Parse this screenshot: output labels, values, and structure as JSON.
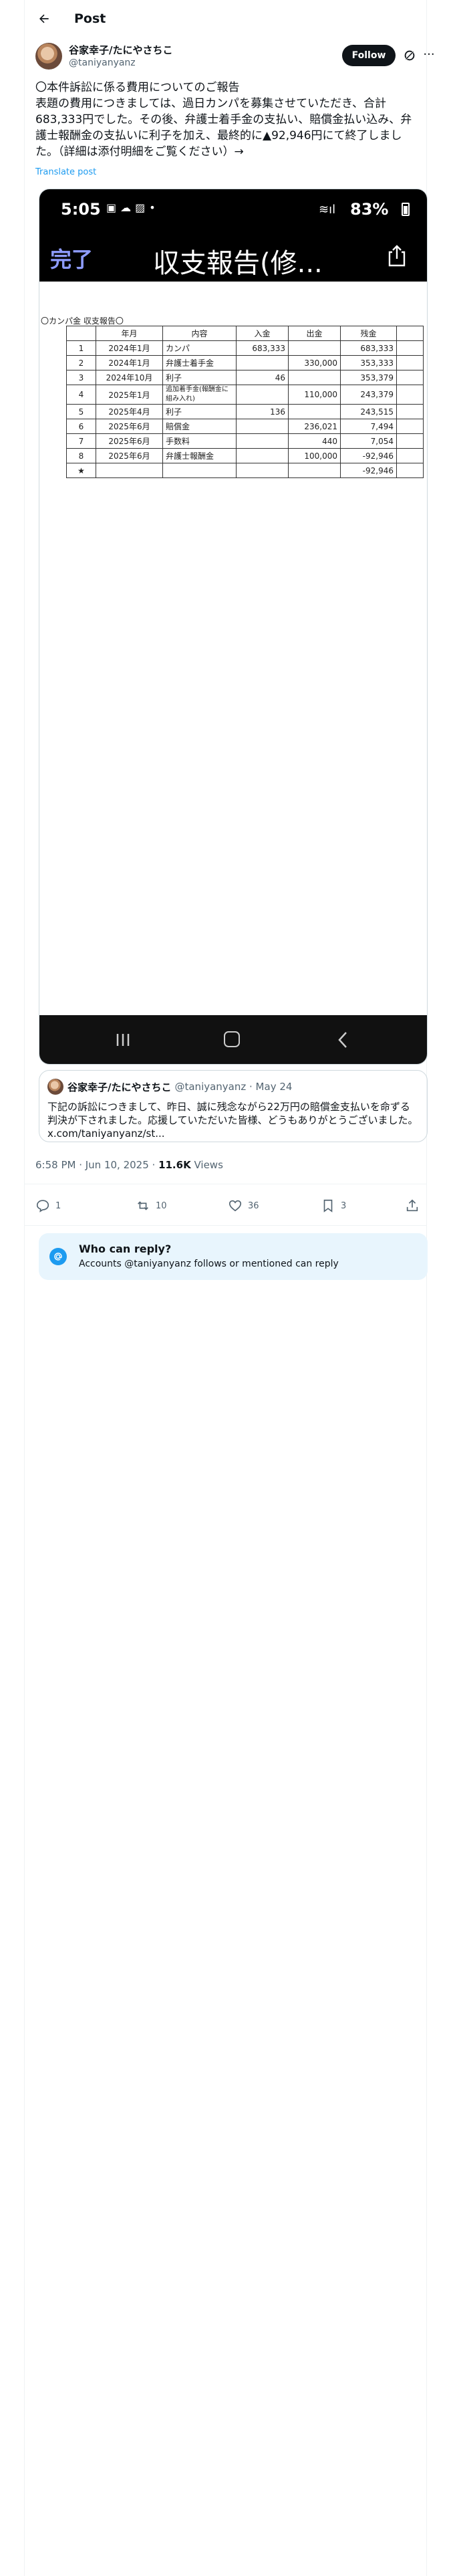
{
  "header": {
    "title": "Post"
  },
  "author": {
    "name": "谷家幸子/たにやさちこ",
    "handle": "@taniyanyanz",
    "follow_label": "Follow"
  },
  "post": {
    "text": "〇本件訴訟に係る費用についてのご報告\n表題の費用につきましては、過日カンパを募集させていただき、合計683,333円でした。その後、弁護士着手金の支払い、賠償金払い込み、弁護士報酬金の支払いに利子を加え、最終的に▲92,946円にて終了しました。（詳細は添付明細をご覧ください）→",
    "translate_label": "Translate post"
  },
  "media": {
    "status_time": "5:05",
    "battery": "83%",
    "done_label": "完了",
    "title": "収支報告(修...",
    "doc_heading": "〇カンパ金 収支報告〇",
    "columns": [
      "年月",
      "内容",
      "入金",
      "出金",
      "残金"
    ],
    "rows": [
      {
        "no": "1",
        "date": "2024年1月",
        "item": "カンパ",
        "in": "683,333",
        "out": "",
        "bal": "683,333"
      },
      {
        "no": "2",
        "date": "2024年1月",
        "item": "弁護士着手金",
        "in": "",
        "out": "330,000",
        "bal": "353,333"
      },
      {
        "no": "3",
        "date": "2024年10月",
        "item": "利子",
        "in": "46",
        "out": "",
        "bal": "353,379"
      },
      {
        "no": "4",
        "date": "2025年1月",
        "item": "追加着手金(報酬金に組み入れ)",
        "in": "",
        "out": "110,000",
        "bal": "243,379"
      },
      {
        "no": "5",
        "date": "2025年4月",
        "item": "利子",
        "in": "136",
        "out": "",
        "bal": "243,515"
      },
      {
        "no": "6",
        "date": "2025年6月",
        "item": "賠償金",
        "in": "",
        "out": "236,021",
        "bal": "7,494"
      },
      {
        "no": "7",
        "date": "2025年6月",
        "item": "手数料",
        "in": "",
        "out": "440",
        "bal": "7,054"
      },
      {
        "no": "8",
        "date": "2025年6月",
        "item": "弁護士報酬金",
        "in": "",
        "out": "100,000",
        "bal": "-92,946"
      },
      {
        "no": "★",
        "date": "",
        "item": "",
        "in": "",
        "out": "",
        "bal": "-92,946"
      }
    ]
  },
  "quote": {
    "name": "谷家幸子/たにやさちこ",
    "handle": "@taniyanyanz · May 24",
    "text": "下記の訴訟につきまして、昨日、誠に残念ながら22万円の賠償金支払いを命ずる判決が下されました。応援していただいた皆様、どうもありがとうございました。",
    "link": "x.com/taniyanyanz/st..."
  },
  "meta": {
    "time": "6:58 PM · Jun 10, 2025 · ",
    "views_count": "11.6K",
    "views_label": " Views"
  },
  "actions": {
    "replies": "1",
    "reposts": "10",
    "likes": "36",
    "bookmarks": "3"
  },
  "reply_box": {
    "title": "Who can reply?",
    "subtitle": "Accounts @taniyanyanz follows or mentioned can reply"
  }
}
